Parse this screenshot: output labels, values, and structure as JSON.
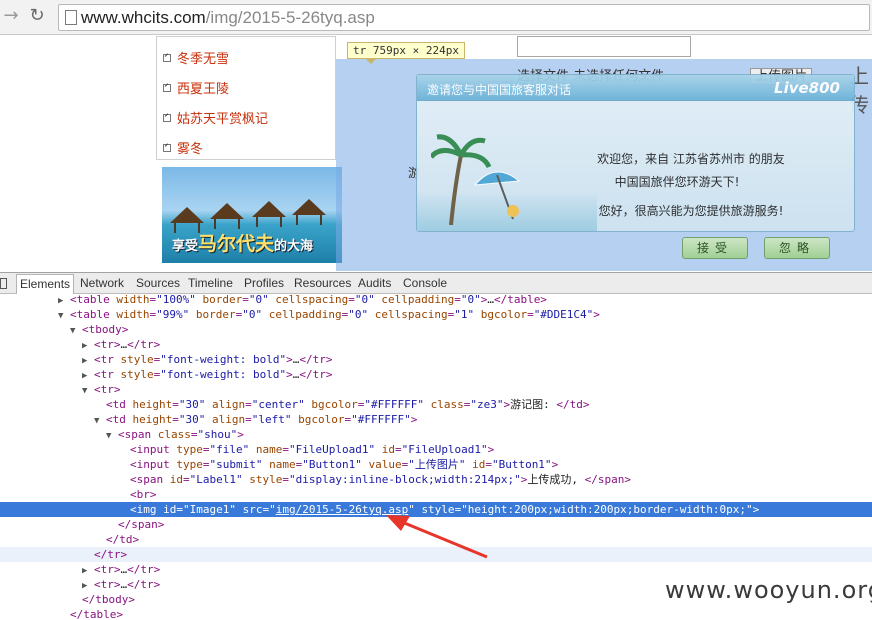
{
  "browser": {
    "url_host": "www.whcits.com",
    "url_path": "/img/2015-5-26tyq.asp",
    "back_icon": "back-arrow-icon",
    "reload_icon": "reload-icon"
  },
  "page": {
    "nav_links": [
      "冬季无雪",
      "西夏王陵",
      "姑苏天平赏枫记",
      "雾冬"
    ],
    "banner_small": "享受",
    "banner_big": "马尔代夫",
    "banner_small2": "的大海",
    "tooltip": "tr 759px × 224px",
    "file_row": "选择文件  未选择任何文件",
    "upload_button": "上传图片",
    "side_char": "游",
    "far_char": "上传",
    "highlight_color": "#78aae6"
  },
  "popup": {
    "title": "邀请您与中国国旅客服对话",
    "brand": "Live800",
    "line1": "欢迎您，来自 江苏省苏州市 的朋友",
    "line2": "中国国旅伴您环游天下!",
    "line3": "您好，很高兴能为您提供旅游服务!",
    "accept": "接受",
    "ignore": "忽略"
  },
  "devtools": {
    "tabs": [
      "Elements",
      "Network",
      "Sources",
      "Timeline",
      "Profiles",
      "Resources",
      "Audits",
      "Console"
    ],
    "active_tab": "Elements",
    "lines": [
      {
        "indent": 5,
        "tri": "▶",
        "html": [
          [
            "tag",
            "<table "
          ],
          [
            "attr",
            "width"
          ],
          [
            "tag",
            "="
          ],
          [
            "val",
            "\"100%\""
          ],
          [
            "tag",
            " "
          ],
          [
            "attr",
            "border"
          ],
          [
            "tag",
            "="
          ],
          [
            "val",
            "\"0\""
          ],
          [
            "tag",
            " "
          ],
          [
            "attr",
            "cellspacing"
          ],
          [
            "tag",
            "="
          ],
          [
            "val",
            "\"0\""
          ],
          [
            "tag",
            " "
          ],
          [
            "attr",
            "cellpadding"
          ],
          [
            "tag",
            "="
          ],
          [
            "val",
            "\"0\""
          ],
          [
            "tag",
            ">"
          ],
          [
            "txt",
            "…"
          ],
          [
            "tag",
            "</table>"
          ]
        ]
      },
      {
        "indent": 5,
        "tri": "▼",
        "html": [
          [
            "tag",
            "<table "
          ],
          [
            "attr",
            "width"
          ],
          [
            "tag",
            "="
          ],
          [
            "val",
            "\"99%\""
          ],
          [
            "tag",
            " "
          ],
          [
            "attr",
            "border"
          ],
          [
            "tag",
            "="
          ],
          [
            "val",
            "\"0\""
          ],
          [
            "tag",
            " "
          ],
          [
            "attr",
            "cellpadding"
          ],
          [
            "tag",
            "="
          ],
          [
            "val",
            "\"0\""
          ],
          [
            "tag",
            " "
          ],
          [
            "attr",
            "cellspacing"
          ],
          [
            "tag",
            "="
          ],
          [
            "val",
            "\"1\""
          ],
          [
            "tag",
            " "
          ],
          [
            "attr",
            "bgcolor"
          ],
          [
            "tag",
            "="
          ],
          [
            "val",
            "\"#DDE1C4\""
          ],
          [
            "tag",
            ">"
          ]
        ]
      },
      {
        "indent": 6,
        "tri": "▼",
        "html": [
          [
            "tag",
            "<tbody>"
          ]
        ]
      },
      {
        "indent": 7,
        "tri": "▶",
        "html": [
          [
            "tag",
            "<tr>"
          ],
          [
            "txt",
            "…"
          ],
          [
            "tag",
            "</tr>"
          ]
        ]
      },
      {
        "indent": 7,
        "tri": "▶",
        "html": [
          [
            "tag",
            "<tr "
          ],
          [
            "attr",
            "style"
          ],
          [
            "tag",
            "="
          ],
          [
            "val",
            "\"font-weight: bold\""
          ],
          [
            "tag",
            ">"
          ],
          [
            "txt",
            "…"
          ],
          [
            "tag",
            "</tr>"
          ]
        ]
      },
      {
        "indent": 7,
        "tri": "▶",
        "html": [
          [
            "tag",
            "<tr "
          ],
          [
            "attr",
            "style"
          ],
          [
            "tag",
            "="
          ],
          [
            "val",
            "\"font-weight: bold\""
          ],
          [
            "tag",
            ">"
          ],
          [
            "txt",
            "…"
          ],
          [
            "tag",
            "</tr>"
          ]
        ]
      },
      {
        "indent": 7,
        "tri": "▼",
        "html": [
          [
            "tag",
            "<tr>"
          ]
        ]
      },
      {
        "indent": 8,
        "tri": "",
        "html": [
          [
            "tag",
            "<td "
          ],
          [
            "attr",
            "height"
          ],
          [
            "tag",
            "="
          ],
          [
            "val",
            "\"30\""
          ],
          [
            "tag",
            " "
          ],
          [
            "attr",
            "align"
          ],
          [
            "tag",
            "="
          ],
          [
            "val",
            "\"center\""
          ],
          [
            "tag",
            " "
          ],
          [
            "attr",
            "bgcolor"
          ],
          [
            "tag",
            "="
          ],
          [
            "val",
            "\"#FFFFFF\""
          ],
          [
            "tag",
            " "
          ],
          [
            "attr",
            "class"
          ],
          [
            "tag",
            "="
          ],
          [
            "val",
            "\"ze3\""
          ],
          [
            "tag",
            ">"
          ],
          [
            "txt",
            "游记图: "
          ],
          [
            "tag",
            "</td>"
          ]
        ]
      },
      {
        "indent": 8,
        "tri": "▼",
        "html": [
          [
            "tag",
            "<td "
          ],
          [
            "attr",
            "height"
          ],
          [
            "tag",
            "="
          ],
          [
            "val",
            "\"30\""
          ],
          [
            "tag",
            " "
          ],
          [
            "attr",
            "align"
          ],
          [
            "tag",
            "="
          ],
          [
            "val",
            "\"left\""
          ],
          [
            "tag",
            " "
          ],
          [
            "attr",
            "bgcolor"
          ],
          [
            "tag",
            "="
          ],
          [
            "val",
            "\"#FFFFFF\""
          ],
          [
            "tag",
            ">"
          ]
        ]
      },
      {
        "indent": 9,
        "tri": "▼",
        "html": [
          [
            "tag",
            "<span "
          ],
          [
            "attr",
            "class"
          ],
          [
            "tag",
            "="
          ],
          [
            "val",
            "\"shou\""
          ],
          [
            "tag",
            ">"
          ]
        ]
      },
      {
        "indent": 10,
        "tri": "",
        "html": [
          [
            "tag",
            "<input "
          ],
          [
            "attr",
            "type"
          ],
          [
            "tag",
            "="
          ],
          [
            "val",
            "\"file\""
          ],
          [
            "tag",
            " "
          ],
          [
            "attr",
            "name"
          ],
          [
            "tag",
            "="
          ],
          [
            "val",
            "\"FileUpload1\""
          ],
          [
            "tag",
            " "
          ],
          [
            "attr",
            "id"
          ],
          [
            "tag",
            "="
          ],
          [
            "val",
            "\"FileUpload1\""
          ],
          [
            "tag",
            ">"
          ]
        ]
      },
      {
        "indent": 10,
        "tri": "",
        "html": [
          [
            "tag",
            "<input "
          ],
          [
            "attr",
            "type"
          ],
          [
            "tag",
            "="
          ],
          [
            "val",
            "\"submit\""
          ],
          [
            "tag",
            " "
          ],
          [
            "attr",
            "name"
          ],
          [
            "tag",
            "="
          ],
          [
            "val",
            "\"Button1\""
          ],
          [
            "tag",
            " "
          ],
          [
            "attr",
            "value"
          ],
          [
            "tag",
            "="
          ],
          [
            "val",
            "\"上传图片\""
          ],
          [
            "tag",
            " "
          ],
          [
            "attr",
            "id"
          ],
          [
            "tag",
            "="
          ],
          [
            "val",
            "\"Button1\""
          ],
          [
            "tag",
            ">"
          ]
        ]
      },
      {
        "indent": 10,
        "tri": "",
        "html": [
          [
            "tag",
            "<span "
          ],
          [
            "attr",
            "id"
          ],
          [
            "tag",
            "="
          ],
          [
            "val",
            "\"Label1\""
          ],
          [
            "tag",
            " "
          ],
          [
            "attr",
            "style"
          ],
          [
            "tag",
            "="
          ],
          [
            "val",
            "\"display:inline-block;width:214px;\""
          ],
          [
            "tag",
            ">"
          ],
          [
            "txt",
            "上传成功, "
          ],
          [
            "tag",
            "</span>"
          ]
        ]
      },
      {
        "indent": 10,
        "tri": "",
        "html": [
          [
            "tag",
            "<br>"
          ]
        ]
      },
      {
        "indent": 10,
        "tri": "",
        "sel": true,
        "html": [
          [
            "tag",
            "<img "
          ],
          [
            "attr",
            "id"
          ],
          [
            "tag",
            "="
          ],
          [
            "val",
            "\"Image1\""
          ],
          [
            "tag",
            " "
          ],
          [
            "attr",
            "src"
          ],
          [
            "tag",
            "="
          ],
          [
            "val",
            "\""
          ],
          [
            "link",
            "img/2015-5-26tyq.asp"
          ],
          [
            "val",
            "\""
          ],
          [
            "tag",
            " "
          ],
          [
            "attr",
            "style"
          ],
          [
            "tag",
            "="
          ],
          [
            "val",
            "\"height:200px;width:200px;border-width:0px;\""
          ],
          [
            "tag",
            ">"
          ]
        ]
      },
      {
        "indent": 9,
        "tri": "",
        "html": [
          [
            "tag",
            "</span>"
          ]
        ]
      },
      {
        "indent": 8,
        "tri": "",
        "html": [
          [
            "tag",
            "</td>"
          ]
        ]
      },
      {
        "indent": 7,
        "tri": "",
        "hov": true,
        "html": [
          [
            "tag",
            "</tr>"
          ]
        ]
      },
      {
        "indent": 7,
        "tri": "▶",
        "html": [
          [
            "tag",
            "<tr>"
          ],
          [
            "txt",
            "…"
          ],
          [
            "tag",
            "</tr>"
          ]
        ]
      },
      {
        "indent": 7,
        "tri": "▶",
        "html": [
          [
            "tag",
            "<tr>"
          ],
          [
            "txt",
            "…"
          ],
          [
            "tag",
            "</tr>"
          ]
        ]
      },
      {
        "indent": 6,
        "tri": "",
        "html": [
          [
            "tag",
            "</tbody>"
          ]
        ]
      },
      {
        "indent": 5,
        "tri": "",
        "html": [
          [
            "tag",
            "</table>"
          ]
        ]
      }
    ]
  },
  "watermark": "www.wooyun.org",
  "annotation_arrow_color": "#e8352a"
}
